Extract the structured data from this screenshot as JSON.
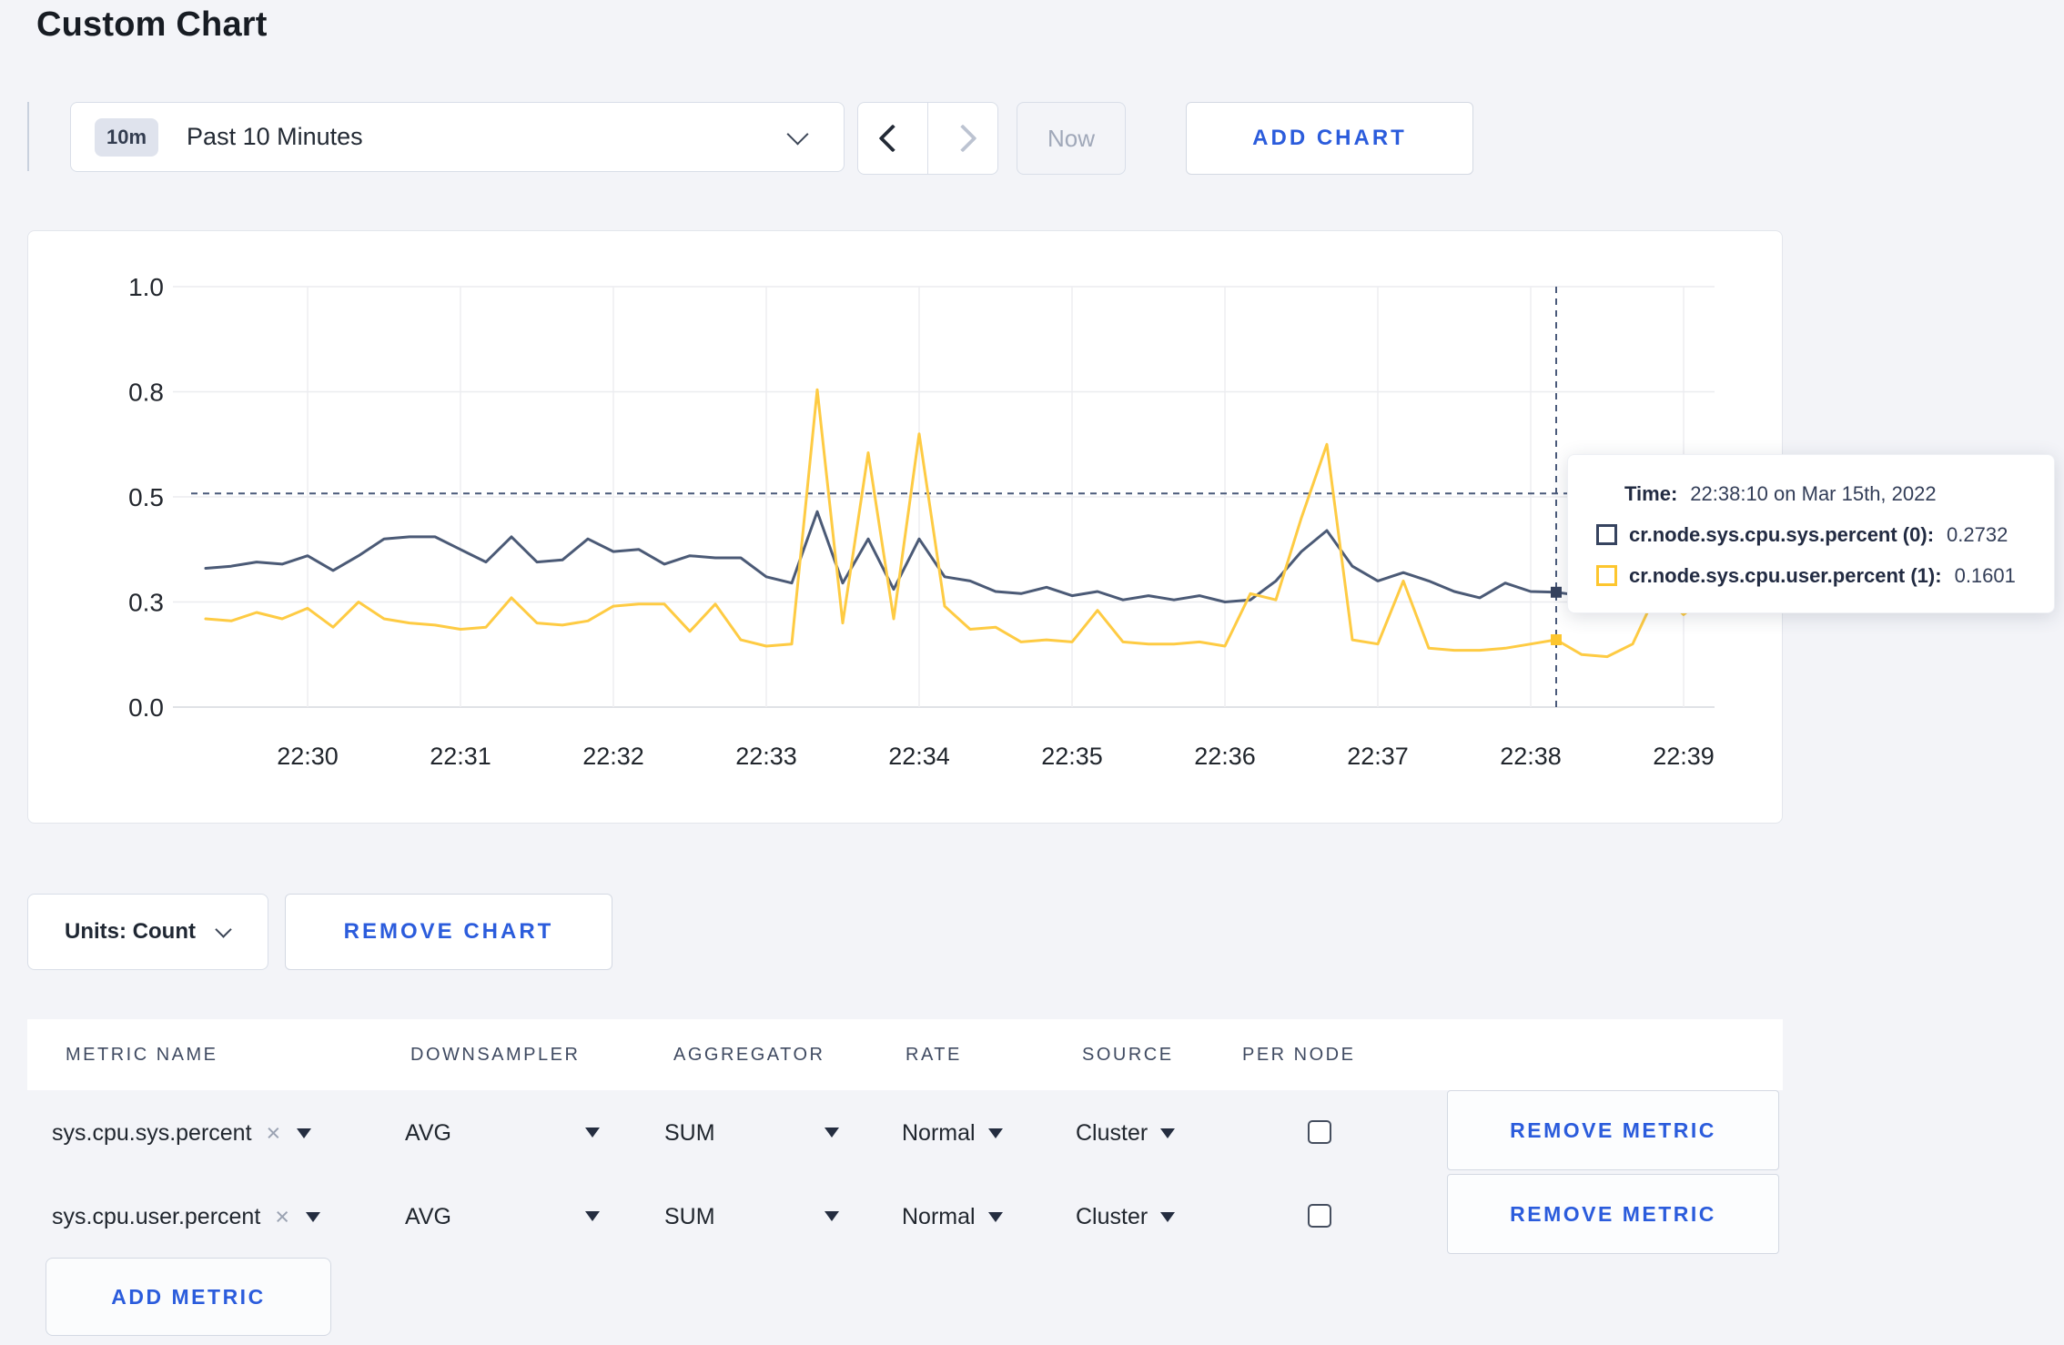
{
  "header": {
    "title": "Custom Chart"
  },
  "toolbar": {
    "time_badge": "10m",
    "time_label": "Past 10 Minutes",
    "prev_icon": "chevron-left",
    "next_icon": "chevron-right",
    "now_label": "Now",
    "add_chart_label": "ADD CHART"
  },
  "controls": {
    "units_label": "Units: Count",
    "remove_chart_label": "REMOVE CHART"
  },
  "tooltip": {
    "time_label": "Time:",
    "time_value": "22:38:10 on Mar 15th, 2022",
    "rows": [
      {
        "label": "cr.node.sys.cpu.sys.percent (0):",
        "value": "0.2732",
        "color": "#36435f"
      },
      {
        "label": "cr.node.sys.cpu.user.percent (1):",
        "value": "0.1601",
        "color": "#fdc62e"
      }
    ]
  },
  "metrics_table": {
    "headers": [
      "METRIC NAME",
      "DOWNSAMPLER",
      "AGGREGATOR",
      "RATE",
      "SOURCE",
      "PER NODE"
    ],
    "rows": [
      {
        "metric_name": "sys.cpu.sys.percent",
        "clear_icon": "×",
        "downsampler": "AVG",
        "aggregator": "SUM",
        "rate": "Normal",
        "source": "Cluster",
        "per_node_checked": false,
        "remove_label": "REMOVE METRIC"
      },
      {
        "metric_name": "sys.cpu.user.percent",
        "clear_icon": "×",
        "downsampler": "AVG",
        "aggregator": "SUM",
        "rate": "Normal",
        "source": "Cluster",
        "per_node_checked": false,
        "remove_label": "REMOVE METRIC"
      }
    ],
    "add_metric_label": "ADD METRIC"
  },
  "colors": {
    "action_blue": "#2b5cdc",
    "series_sys": "#4b5a76",
    "series_user": "#fecb43",
    "crosshair": "#4a5a7a"
  },
  "chart_data": {
    "type": "line",
    "title": "",
    "xlabel": "",
    "ylabel": "",
    "x_start": "22:29:20",
    "x_interval_seconds": 10,
    "x_tick_labels": [
      "22:30",
      "22:31",
      "22:32",
      "22:33",
      "22:34",
      "22:35",
      "22:36",
      "22:37",
      "22:38",
      "22:39"
    ],
    "x_tick_indices": [
      4,
      10,
      16,
      22,
      28,
      34,
      40,
      46,
      52,
      58
    ],
    "y_ticks": [
      {
        "value": 0.0,
        "label": "0.0"
      },
      {
        "value": 0.25,
        "label": "0.3"
      },
      {
        "value": 0.5,
        "label": "0.5"
      },
      {
        "value": 0.75,
        "label": "0.8"
      },
      {
        "value": 1.0,
        "label": "1.0"
      }
    ],
    "ylim": [
      0,
      1
    ],
    "grid": true,
    "legend_position": "tooltip",
    "series": [
      {
        "name": "cr.node.sys.cpu.sys.percent",
        "color": "#4b5a76",
        "values": [
          0.33,
          0.335,
          0.345,
          0.34,
          0.36,
          0.325,
          0.36,
          0.4,
          0.405,
          0.405,
          0.375,
          0.345,
          0.405,
          0.345,
          0.35,
          0.4,
          0.37,
          0.375,
          0.34,
          0.36,
          0.355,
          0.355,
          0.31,
          0.295,
          0.465,
          0.295,
          0.4,
          0.28,
          0.4,
          0.31,
          0.3,
          0.275,
          0.27,
          0.285,
          0.265,
          0.275,
          0.255,
          0.265,
          0.255,
          0.265,
          0.25,
          0.255,
          0.3,
          0.37,
          0.42,
          0.335,
          0.3,
          0.32,
          0.3,
          0.275,
          0.26,
          0.295,
          0.275,
          0.2732,
          0.265,
          0.27,
          0.28,
          0.275,
          0.285,
          0.27
        ]
      },
      {
        "name": "cr.node.sys.cpu.user.percent",
        "color": "#fecb43",
        "values": [
          0.21,
          0.205,
          0.225,
          0.21,
          0.235,
          0.19,
          0.25,
          0.21,
          0.2,
          0.195,
          0.185,
          0.19,
          0.26,
          0.2,
          0.195,
          0.205,
          0.24,
          0.245,
          0.245,
          0.18,
          0.245,
          0.16,
          0.145,
          0.15,
          0.755,
          0.2,
          0.605,
          0.21,
          0.65,
          0.24,
          0.185,
          0.19,
          0.155,
          0.16,
          0.155,
          0.23,
          0.155,
          0.15,
          0.15,
          0.155,
          0.145,
          0.27,
          0.255,
          0.45,
          0.625,
          0.16,
          0.15,
          0.3,
          0.14,
          0.135,
          0.135,
          0.14,
          0.15,
          0.1601,
          0.125,
          0.12,
          0.15,
          0.28,
          0.22,
          0.27
        ]
      }
    ],
    "crosshair": {
      "time": "22:38:10",
      "index": 53,
      "hover_value": 0.508,
      "sys_value": 0.2732,
      "user_value": 0.1601
    }
  }
}
